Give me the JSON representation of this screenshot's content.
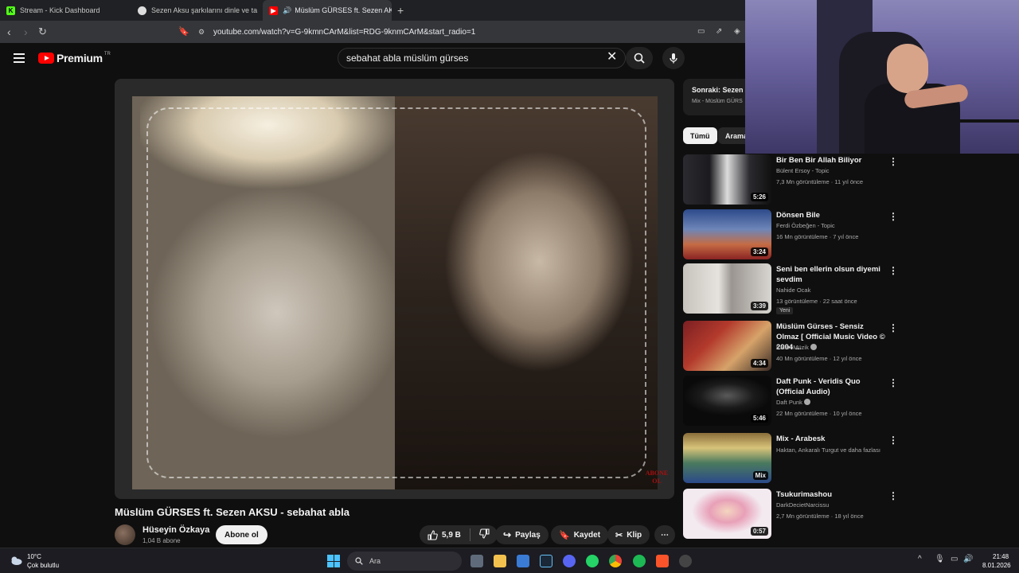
{
  "browser": {
    "tabs": [
      {
        "title": "Stream - Kick Dashboard",
        "active": false
      },
      {
        "title": "Sezen Aksu şarkılarını dinle ve ta",
        "active": false
      },
      {
        "title": "Müslüm GÜRSES ft. Sezen AK",
        "active": true
      }
    ],
    "new_tab": "+",
    "url": "youtube.com/watch?v=G-9kmnCArM&list=RDG-9knmCArM&start_radio=1"
  },
  "yt": {
    "logo_text": "Premium",
    "logo_country": "TR",
    "search_query": "sebahat abla müslüm gürses"
  },
  "video": {
    "title": "Müslüm GÜRSES ft. Sezen AKSU - sebahat abla",
    "overlay_text": "ABONE OL",
    "channel_name": "Hüseyin Özkaya",
    "subscribers": "1,04 B abone",
    "subscribe_label": "Abone ol",
    "likes": "5,9 B",
    "share_label": "Paylaş",
    "save_label": "Kaydet",
    "clip_label": "Klip"
  },
  "sidebar": {
    "upnext_label": "Sonraki: Sezen A",
    "upnext_sub": "Mix - Müslüm GÜRS",
    "chips": [
      "Tümü",
      "Arama"
    ],
    "recs": [
      {
        "title": "Bir Ben Bir Allah Biliyor",
        "channel": "Bülent Ersoy - Topic",
        "stats": "7,3 Mn görüntüleme · 11 yıl önce",
        "duration": "5:26"
      },
      {
        "title": "Dönsen Bile",
        "channel": "Ferdi Özbeğen - Topic",
        "stats": "16 Mn görüntüleme · 7 yıl önce",
        "duration": "3:24"
      },
      {
        "title": "Seni ben ellerin olsun diyemi sevdim",
        "channel": "Nahide Ocak",
        "stats": "13 görüntüleme · 22 saat önce",
        "duration": "3:39",
        "badge": "Yeni"
      },
      {
        "title": "Müslüm Gürses - Sensiz Olmaz [ Official Music Video © 2004 ...",
        "channel": "Kalan Müzik",
        "stats": "40 Mn görüntüleme · 12 yıl önce",
        "duration": "4:34"
      },
      {
        "title": "Daft Punk - Veridis Quo (Official Audio)",
        "channel": "Daft Punk",
        "stats": "22 Mn görüntüleme · 10 yıl önce",
        "duration": "5:46"
      },
      {
        "title": "Mix - Arabesk",
        "channel": "Haktan, Ankaralı Turgut ve daha fazlası",
        "stats": "",
        "duration": "Mix"
      },
      {
        "title": "Tsukurimashou",
        "channel": "DarkDecietNarcissu",
        "stats": "2,7 Mn görüntüleme · 18 yıl önce",
        "duration": "0:57"
      }
    ]
  },
  "taskbar": {
    "temperature": "10°C",
    "weather": "Çok bulutlu",
    "search_label": "Ara",
    "time": "21:48",
    "date": "8.01.2026"
  },
  "colors": {
    "yt_red": "#ff0000",
    "background": "#0f0f0f",
    "windows_blue": "#4cc2ff"
  }
}
